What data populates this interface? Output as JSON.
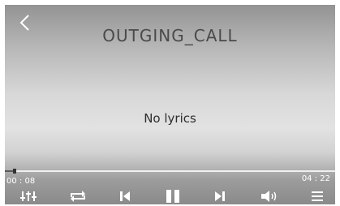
{
  "player": {
    "title": "OUTGING_CALL",
    "lyrics_text": "No lyrics",
    "elapsed": "00 : 08",
    "total": "04 : 22",
    "progress_fraction": 0.03
  },
  "controls": [
    "equalizer-icon",
    "repeat-icon",
    "previous-icon",
    "pause-icon",
    "next-icon",
    "volume-icon",
    "menu-icon"
  ],
  "colors": {
    "icon": "#ffffff",
    "progress_track": "#f0f0f0",
    "progress_fill": "#5a5a5a"
  }
}
